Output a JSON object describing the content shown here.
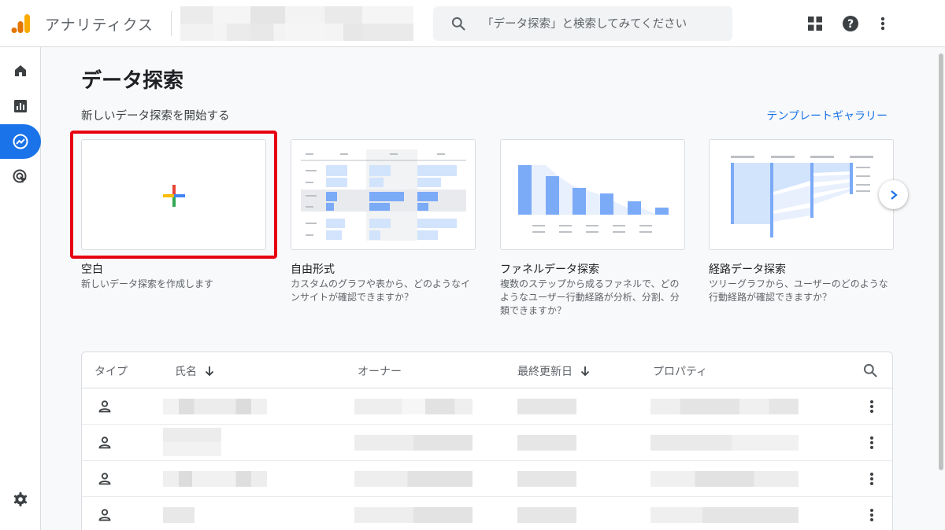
{
  "header": {
    "app_title": "アナリティクス",
    "search_placeholder": "「データ探索」と検索してみてください"
  },
  "page": {
    "title": "データ探索",
    "section_label": "新しいデータ探索を開始する",
    "template_gallery_link": "テンプレートギャラリー"
  },
  "cards": [
    {
      "title": "空白",
      "description": "新しいデータ探索を作成します"
    },
    {
      "title": "自由形式",
      "description": "カスタムのグラフや表から、どのようなインサイトが確認できますか？"
    },
    {
      "title": "ファネルデータ探索",
      "description": "複数のステップから成るファネルで、どのようなユーザー行動経路が分析、分割、分類できますか？"
    },
    {
      "title": "経路データ探索",
      "description": "ツリーグラフから、ユーザーのどのような行動経路が確認できますか？"
    }
  ],
  "table": {
    "headers": {
      "type": "タイプ",
      "name": "氏名",
      "owner": "オーナー",
      "last_updated": "最終更新日",
      "property": "プロパティ"
    }
  },
  "colors": {
    "accent": "#1a73e8",
    "highlight_frame": "#e60012",
    "analytics_orange": "#f9ab00",
    "analytics_dark_orange": "#e37400"
  },
  "icons": {
    "sidebar": [
      "home-icon",
      "reports-icon",
      "explore-icon",
      "advertising-icon",
      "settings-icon"
    ],
    "top_right": [
      "apps-grid-icon",
      "help-icon",
      "more-vert-icon"
    ]
  }
}
